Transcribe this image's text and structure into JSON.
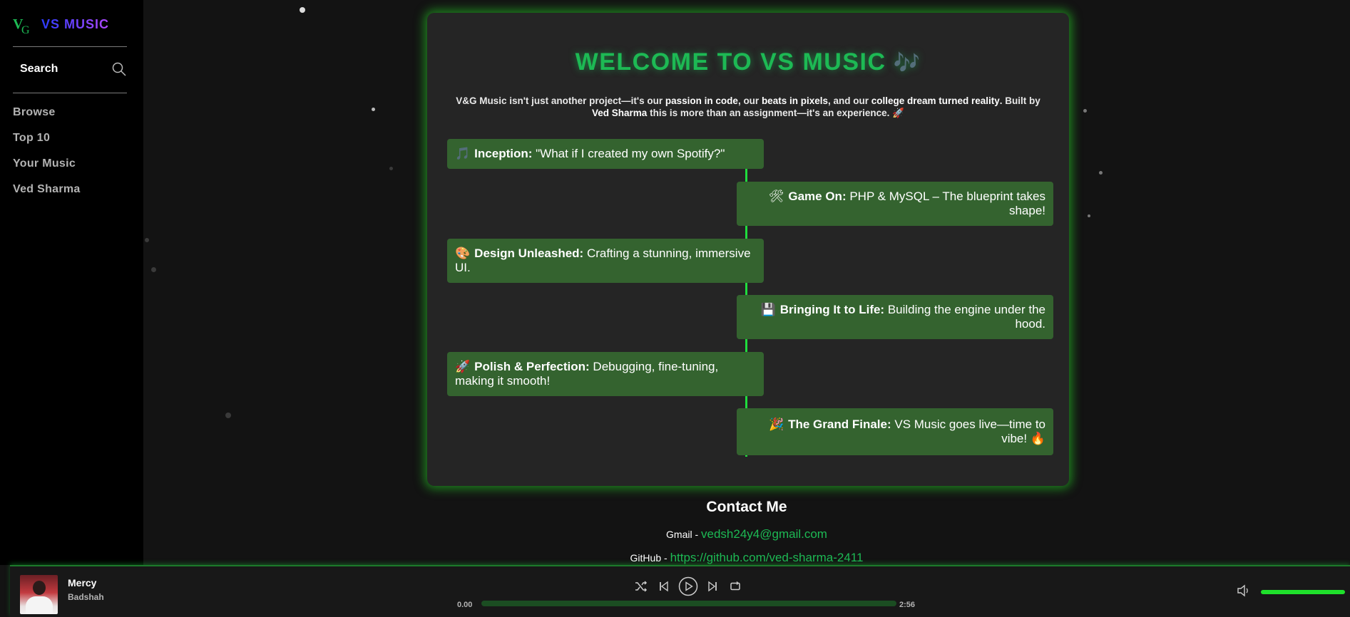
{
  "sidebar": {
    "logo_text": "VS MUSIC",
    "search_label": "Search",
    "nav": [
      "Browse",
      "Top 10",
      "Your Music",
      "Ved Sharma"
    ]
  },
  "about": {
    "title": "WELCOME TO VS MUSIC",
    "title_emoji": "🎶",
    "intro_1": "V&G Music isn't just another project—it's our ",
    "intro_b1": "passion in code",
    "intro_2": ", our ",
    "intro_b2": "beats in pixels",
    "intro_3": ", and our ",
    "intro_b3": "college dream turned reality",
    "intro_4": ". Built by ",
    "intro_b4": "Ved Sharma",
    "intro_5": " this is more than an assignment—it's an experience. 🚀",
    "timeline": [
      {
        "icon": "🎵",
        "title": "Inception:",
        "text": " \"What if I created my own Spotify?\""
      },
      {
        "icon": "🛠",
        "title": "Game On:",
        "text": " PHP & MySQL – The blueprint takes shape!"
      },
      {
        "icon": "🎨",
        "title": "Design Unleashed:",
        "text": " Crafting a stunning, immersive UI."
      },
      {
        "icon": "💾",
        "title": "Bringing It to Life:",
        "text": " Building the engine under the hood."
      },
      {
        "icon": "🚀",
        "title": "Polish & Perfection:",
        "text": " Debugging, fine-tuning, making it smooth!"
      },
      {
        "icon": "🎉",
        "title": "The Grand Finale:",
        "text": " VS Music goes live—time to vibe! 🔥"
      }
    ]
  },
  "contact": {
    "title": "Contact Me",
    "gmail_label": "Gmail - ",
    "gmail": "vedsh24y4@gmail.com",
    "github_label": "GitHub - ",
    "github": "https://github.com/ved-sharma-2411"
  },
  "player": {
    "track": "Mercy",
    "artist": "Badshah",
    "current_time": "0.00",
    "duration": "2:56",
    "progress": 0,
    "volume": 1.0
  },
  "colors": {
    "accent": "#1db954",
    "glow": "#1fdc3d",
    "timeline_card": "#34632f"
  }
}
